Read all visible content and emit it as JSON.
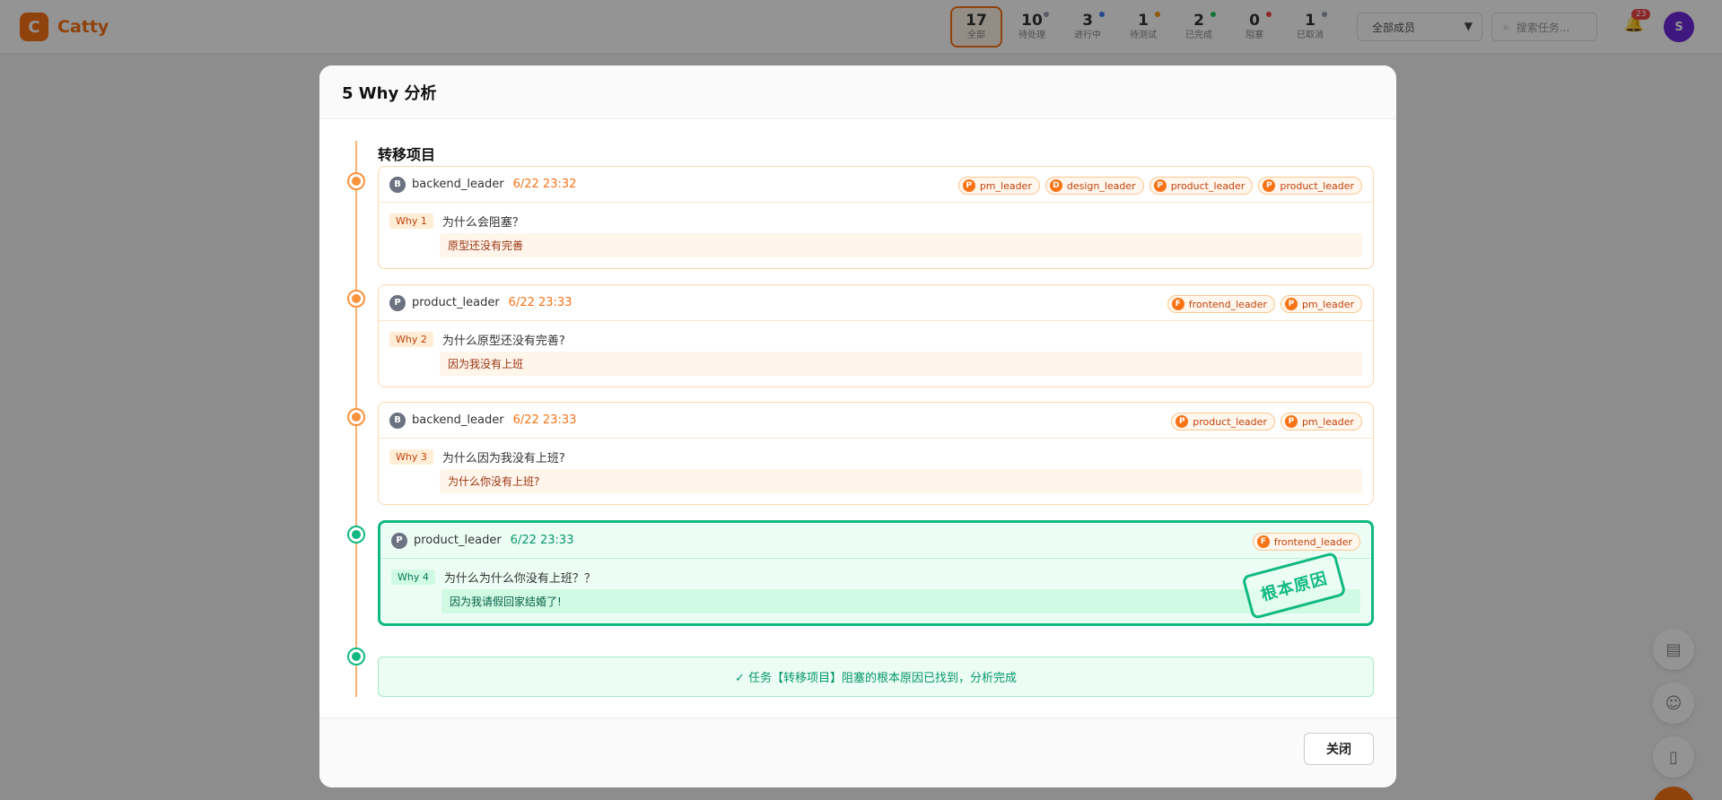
{
  "app": {
    "logo_letter": "C",
    "name": "Catty"
  },
  "stats": [
    {
      "num": "17",
      "label": "全部",
      "active": true,
      "dot": ""
    },
    {
      "num": "10",
      "label": "待处理",
      "active": false,
      "dot": "#9ca3af"
    },
    {
      "num": "3",
      "label": "进行中",
      "active": false,
      "dot": "#3b82f6"
    },
    {
      "num": "1",
      "label": "待测试",
      "active": false,
      "dot": "#f59e0b"
    },
    {
      "num": "2",
      "label": "已完成",
      "active": false,
      "dot": "#22c55e"
    },
    {
      "num": "0",
      "label": "阻塞",
      "active": false,
      "dot": "#ef4444"
    },
    {
      "num": "1",
      "label": "已取消",
      "active": false,
      "dot": "#9ca3af"
    }
  ],
  "header": {
    "filter_value": "全部成员",
    "search_placeholder": "搜索任务...",
    "bell_badge": "23",
    "user_initial": "S"
  },
  "modal": {
    "title": "5 Why 分析",
    "section_title": "转移项目",
    "close_label": "关闭",
    "cards": [
      {
        "avatar": "B",
        "author": "backend_leader",
        "time": "6/22 23:32",
        "tags": [
          {
            "initial": "P",
            "name": "pm_leader"
          },
          {
            "initial": "D",
            "name": "design_leader"
          },
          {
            "initial": "P",
            "name": "product_leader"
          },
          {
            "initial": "P",
            "name": "product_leader"
          }
        ],
        "why": "Why 1",
        "question": "为什么会阻塞？",
        "answer": "原型还没有完善"
      },
      {
        "avatar": "P",
        "author": "product_leader",
        "time": "6/22 23:33",
        "tags": [
          {
            "initial": "F",
            "name": "frontend_leader"
          },
          {
            "initial": "P",
            "name": "pm_leader"
          }
        ],
        "why": "Why 2",
        "question": "为什么原型还没有完善?",
        "answer": "因为我没有上班"
      },
      {
        "avatar": "B",
        "author": "backend_leader",
        "time": "6/22 23:33",
        "tags": [
          {
            "initial": "P",
            "name": "product_leader"
          },
          {
            "initial": "P",
            "name": "pm_leader"
          }
        ],
        "why": "Why 3",
        "question": "为什么因为我没有上班?",
        "answer": "为什么你没有上班?"
      },
      {
        "avatar": "P",
        "author": "product_leader",
        "time": "6/22 23:33",
        "tags": [
          {
            "initial": "F",
            "name": "frontend_leader"
          }
        ],
        "why": "Why 4",
        "question": "为什么为什么你没有上班？？",
        "answer": "因为我请假回家结婚了!"
      }
    ],
    "root_stamp": "根本原因",
    "done_message": "✓ 任务【转移项目】阻塞的根本原因已找到，分析完成"
  },
  "colors": {
    "brand": "#f97316",
    "success": "#10b981"
  }
}
